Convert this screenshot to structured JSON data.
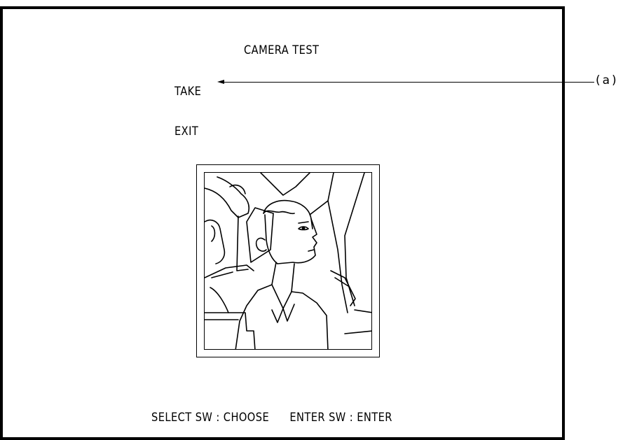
{
  "screen": {
    "title": "CAMERA TEST",
    "menu": [
      {
        "label": "TAKE",
        "selected": true
      },
      {
        "label": "EXIT",
        "selected": false
      }
    ],
    "footer": {
      "select_hint": "SELECT SW : CHOOSE",
      "enter_hint": "ENTER SW : ENTER"
    }
  },
  "annotation": {
    "callout_label": "(a)"
  },
  "photo": {
    "subject_icon": "camera-preview-driver"
  }
}
